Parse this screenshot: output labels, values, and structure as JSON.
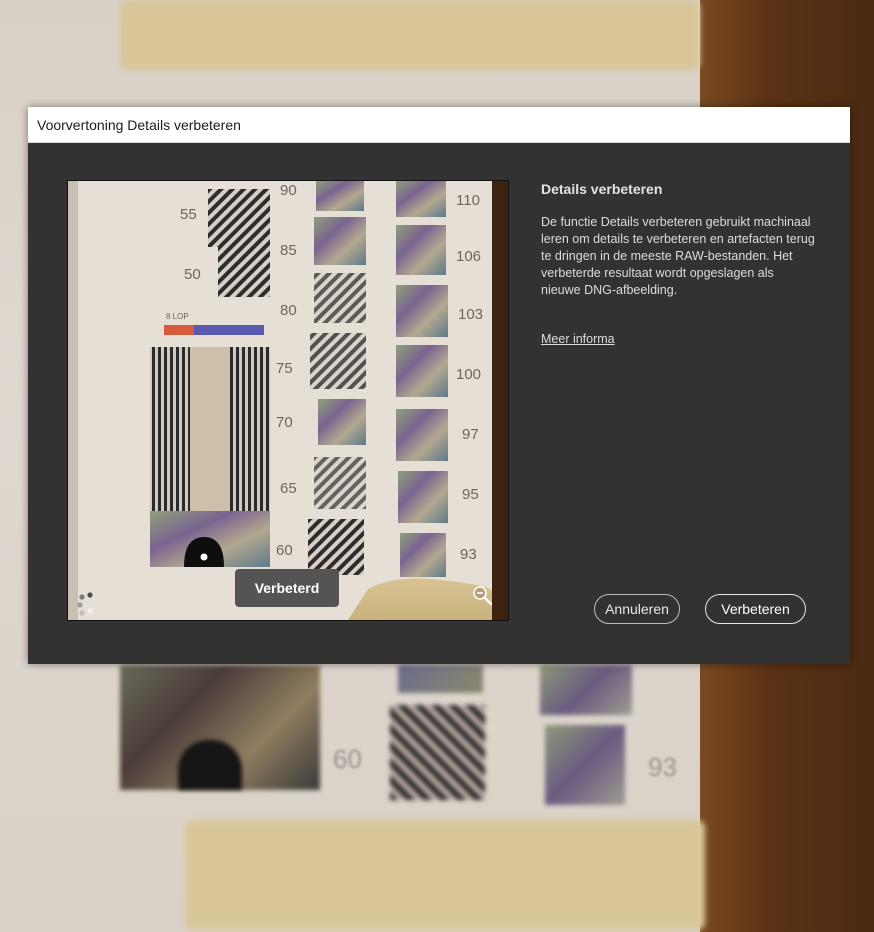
{
  "dialog": {
    "title": "Voorvertoning Details verbeteren"
  },
  "preview": {
    "badge_label": "Verbeterd",
    "chart_numbers": [
      "55",
      "50",
      "90",
      "85",
      "80",
      "75",
      "70",
      "65",
      "60",
      "110",
      "106",
      "103",
      "100",
      "97",
      "95",
      "93"
    ],
    "chart_small_label": "8 LOP",
    "zoom_icon": "zoom-out-icon",
    "spinner_icon": "loading-spinner-icon"
  },
  "info": {
    "heading": "Details verbeteren",
    "body": "De functie Details verbeteren gebruikt machinaal leren om details te verbeteren en artefacten terug te dringen in de meeste RAW-bestanden. Het verbeterde resultaat wordt opgeslagen als nieuwe DNG-afbeelding.",
    "link": "Meer informa"
  },
  "buttons": {
    "cancel": "Annuleren",
    "enhance": "Verbeteren"
  },
  "background": {
    "numbers": [
      "60",
      "93"
    ]
  },
  "colors": {
    "dialog_bg": "#323232",
    "titlebar_bg": "#ffffff",
    "badge_bg": "#545454"
  }
}
